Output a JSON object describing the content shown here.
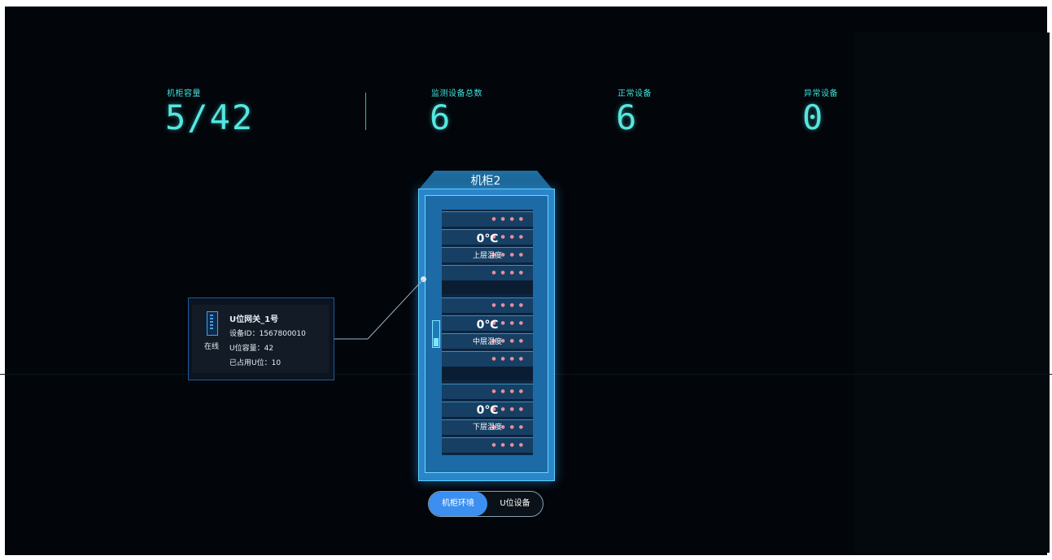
{
  "stats": {
    "cabinet_capacity": {
      "label": "机柜容量",
      "value": "5/42"
    },
    "monitored_total": {
      "label": "监测设备总数",
      "value": "6"
    },
    "normal_devices": {
      "label": "正常设备",
      "value": "6"
    },
    "abnormal_devices": {
      "label": "异常设备",
      "value": "0"
    }
  },
  "cabinet": {
    "name": "机柜2",
    "zones": [
      {
        "temperature": "0℃",
        "label": "上层温度"
      },
      {
        "temperature": "0℃",
        "label": "中层温度"
      },
      {
        "temperature": "0℃",
        "label": "下层温度"
      }
    ]
  },
  "gateway": {
    "title": "U位网关_1号",
    "status": "在线",
    "device_id": "设备ID：1567800010",
    "capacity": "U位容量：42",
    "used": "已占用U位：10"
  },
  "view_toggle": {
    "options": [
      "机柜环境",
      "U位设备"
    ],
    "active": "机柜环境"
  },
  "colors": {
    "accent": "#3fe0d8",
    "cabinet": "#2a86c8",
    "toggle_active": "#3c8ff0",
    "background": "#02060b"
  },
  "icons": {
    "gateway": "gateway-device-icon",
    "unit_indicators": "status-dots"
  }
}
